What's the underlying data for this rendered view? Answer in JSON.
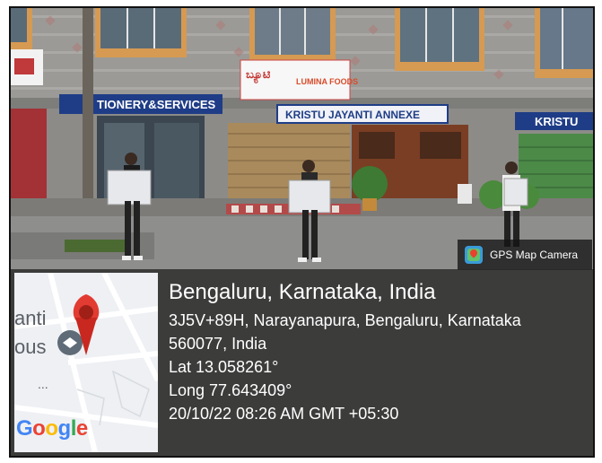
{
  "signs": {
    "shop_left": "TIONERY&SERVICES",
    "center_top_a": "ಬ್ಯೂಟಿ",
    "center_top_b": "LUMINA FOODS",
    "annexe": "KRISTU JAYANTI ANNEXE",
    "right": "KRISTU"
  },
  "badge": {
    "label": "GPS Map Camera"
  },
  "map": {
    "label_top": "anti",
    "label_bottom": "ous",
    "dots": "...",
    "google": [
      "G",
      "o",
      "o",
      "g",
      "l",
      "e"
    ],
    "google_colors": [
      "#4285F4",
      "#EA4335",
      "#FBBC05",
      "#4285F4",
      "#34A853",
      "#EA4335"
    ]
  },
  "location": {
    "city": "Bengaluru, Karnataka, India",
    "address_line1": "3J5V+89H, Narayanapura, Bengaluru, Karnataka",
    "address_line2": "560077, India",
    "lat": "Lat 13.058261°",
    "long": "Long 77.643409°",
    "datetime": "20/10/22 08:26 AM GMT +05:30"
  }
}
